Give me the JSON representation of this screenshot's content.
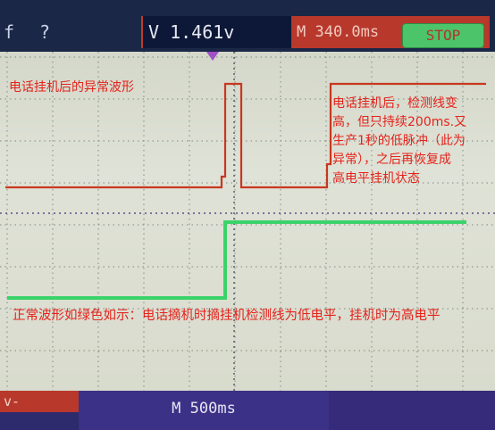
{
  "toolbar": {
    "f_label": "f",
    "help_label": "?",
    "voltage_readout": "V 1.461v",
    "time_readout": "M 340.0ms",
    "stop_label": "STOP"
  },
  "annotations": {
    "left_title": "电话挂机后的异常波形",
    "right_lines": [
      "电话挂机后，检测线变",
      "高，但只持续200ms.又",
      "生产1秒的低脉冲（此为",
      "异常），之后再恢复成",
      "高电平挂机状态"
    ],
    "bottom_note": "正常波形如绿色如示：电话摘机时摘挂机检测线为低电平，挂机时为高电平"
  },
  "status_bar": {
    "left_label": "v-",
    "timebase": "M 500ms"
  },
  "colors": {
    "abnormal_trace": "#c8371f",
    "normal_trace": "#3ad36a",
    "annotation": "#e5231c"
  }
}
